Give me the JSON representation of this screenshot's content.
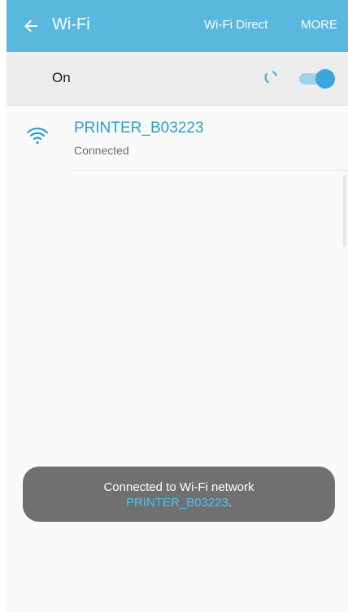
{
  "appbar": {
    "title": "Wi-Fi",
    "back_icon": "arrow-left-icon",
    "wifi_direct_label": "Wi-Fi Direct",
    "more_label": "MORE",
    "background_color": "#5ab7de"
  },
  "wifi_switch": {
    "label": "On",
    "state": "on",
    "scanning_icon": "spinner-icon",
    "accent_color": "#3aa6dc"
  },
  "networks": [
    {
      "name": "PRINTER_B03223",
      "status": "Connected",
      "icon": "wifi-signal-icon"
    }
  ],
  "toast": {
    "message": "Connected to Wi-Fi network",
    "network_name": "PRINTER_B03223",
    "suffix": "."
  }
}
